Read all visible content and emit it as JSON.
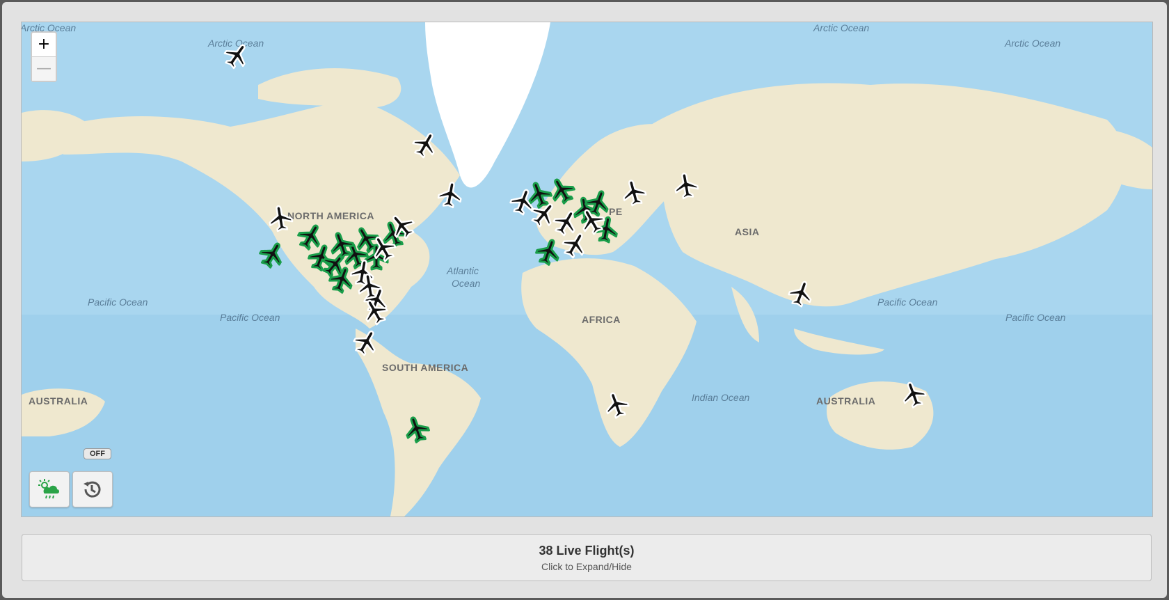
{
  "map": {
    "zoom_in_label": "+",
    "zoom_out_label": "—",
    "labels": [
      {
        "text": "Arctic Ocean",
        "kind": "ocean"
      },
      {
        "text": "Arctic Ocean",
        "kind": "ocean"
      },
      {
        "text": "Arctic Ocean",
        "kind": "ocean"
      },
      {
        "text": "Arctic Ocean",
        "kind": "ocean"
      },
      {
        "text": "NORTH AMERICA",
        "kind": "continent"
      },
      {
        "text": "Atlantic",
        "kind": "ocean"
      },
      {
        "text": "Ocean",
        "kind": "ocean"
      },
      {
        "text": "Pacific Ocean",
        "kind": "ocean"
      },
      {
        "text": "Pacific Ocean",
        "kind": "ocean"
      },
      {
        "text": "Pacific Ocean",
        "kind": "ocean"
      },
      {
        "text": "Pacific Ocean",
        "kind": "ocean"
      },
      {
        "text": "SOUTH AMERICA",
        "kind": "continent"
      },
      {
        "text": "AFRICA",
        "kind": "continent"
      },
      {
        "text": "ASIA",
        "kind": "continent"
      },
      {
        "text": "Indian Ocean",
        "kind": "ocean"
      },
      {
        "text": "AUSTRALIA",
        "kind": "continent"
      },
      {
        "text": "AUSTRALIA",
        "kind": "continent"
      },
      {
        "text": "PE",
        "kind": "continent"
      }
    ],
    "planes_count_shown": 38
  },
  "controls": {
    "weather_icon": "weather-icon",
    "history_icon": "history-icon",
    "history_state": "OFF"
  },
  "flights_panel": {
    "title": "38 Live Flight(s)",
    "subtitle": "Click to Expand/Hide"
  },
  "colors": {
    "ocean": "#a9d6ef",
    "land": "#efe8cf",
    "greenland": "#ffffff",
    "plane_active_glow": "#1a9e4a"
  }
}
